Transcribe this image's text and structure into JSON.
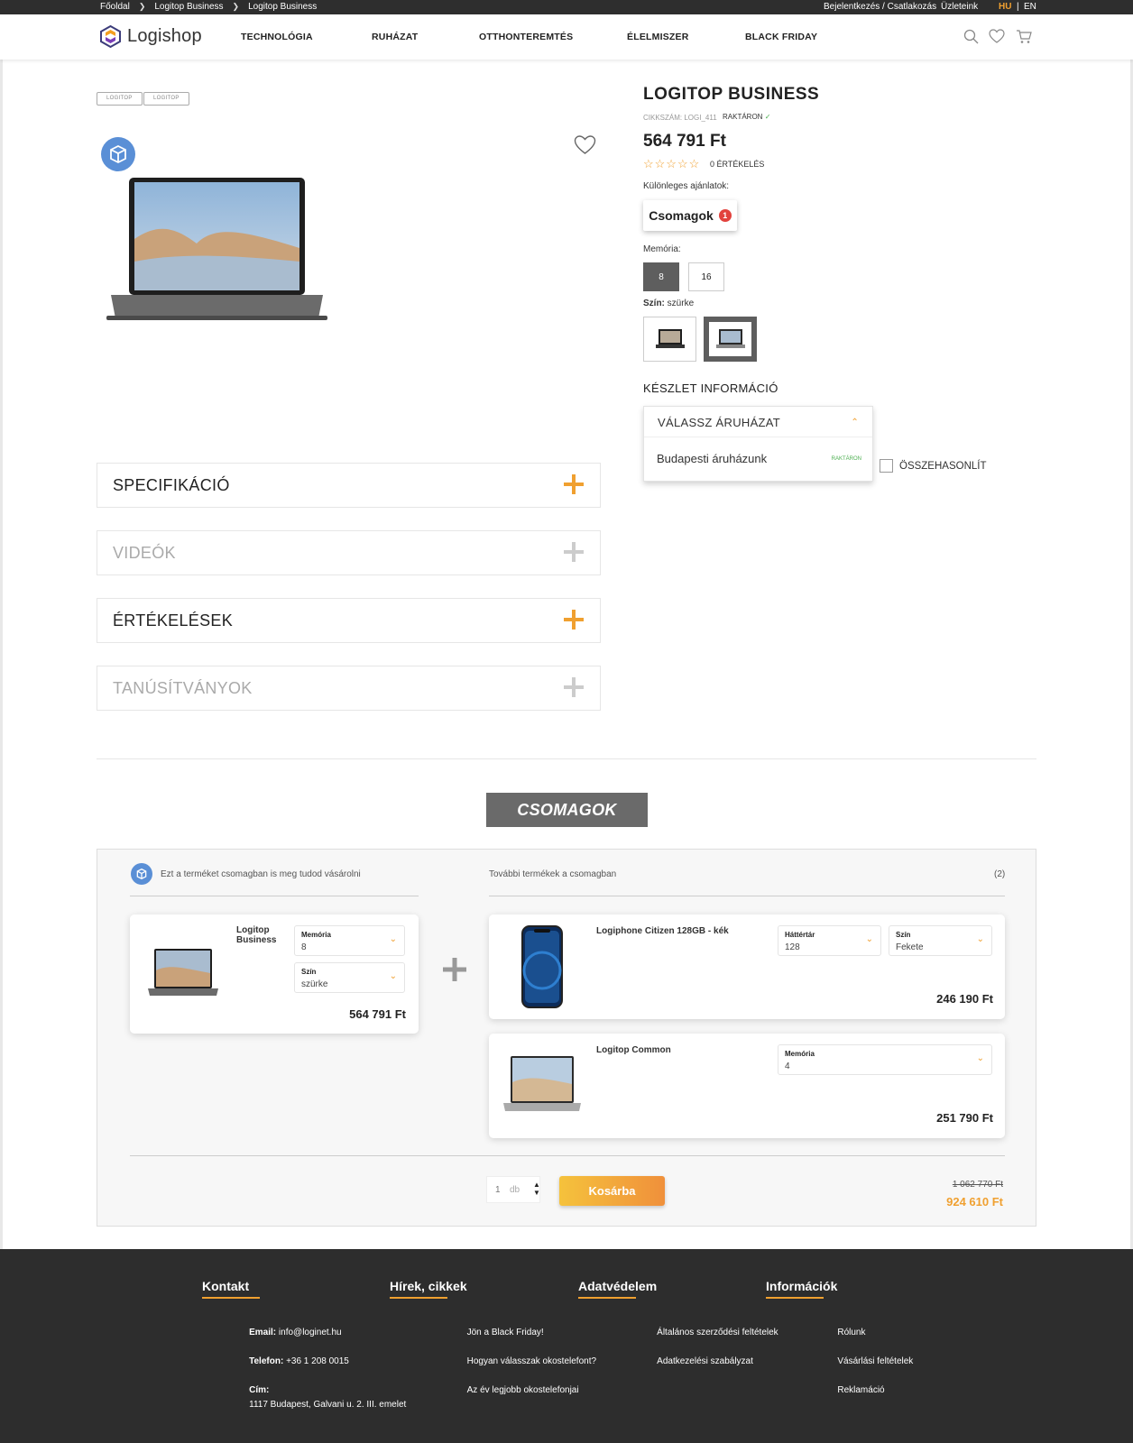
{
  "topbar": {
    "breadcrumb": [
      "Főoldal",
      "Logitop Business",
      "Logitop Business"
    ],
    "login": "Bejelentkezés / Csatlakozás",
    "stores": "Üzleteink",
    "lang_hu": "HU",
    "lang_sep": "|",
    "lang_en": "EN"
  },
  "header": {
    "logo": "Logishop",
    "nav": [
      "TECHNOLÓGIA",
      "RUHÁZAT",
      "OTTHONTEREMTÉS",
      "ÉLELMISZER",
      "BLACK FRIDAY"
    ]
  },
  "product": {
    "tags": [
      "LOGITOP",
      "LOGITOP"
    ],
    "name": "LOGITOP BUSINESS",
    "sku": "CIKKSZÁM: LOGI_411",
    "stock": "RAKTÁRON",
    "price": "564 791 Ft",
    "rating_stars": "☆☆☆☆☆",
    "reviews": "0 ÉRTÉKELÉS",
    "special_label": "Különleges ajánlatok:",
    "special_button": "Csomagok",
    "special_count": "1",
    "memory_label": "Memória:",
    "memory_options": [
      "8",
      "16"
    ],
    "color_label": "Szín:",
    "color_value": "szürke",
    "stock_info": "KÉSZLET INFORMÁCIÓ",
    "store_select": "VÁLASSZ ÁRUHÁZAT",
    "store_name": "Budapesti áruházunk",
    "store_stock": "RAKTÁRON",
    "compare": "ÖSSZEHASONLÍT"
  },
  "accordion": [
    "SPECIFIKÁCIÓ",
    "VIDEÓK",
    "ÉRTÉKELÉSEK",
    "TANÚSÍTVÁNYOK"
  ],
  "bundle": {
    "title": "CSOMAGOK",
    "left_caption": "Ezt a terméket csomagban is meg tudod vásárolni",
    "right_caption": "További termékek a csomagban",
    "count": "(2)",
    "main": {
      "name": "Logitop Business",
      "sel1_title": "Memória",
      "sel1_value": "8",
      "sel2_title": "Szín",
      "sel2_value": "szürke",
      "price": "564 791 Ft"
    },
    "item1": {
      "name": "Logiphone Citizen 128GB - kék",
      "sel1_title": "Háttértár",
      "sel1_value": "128",
      "sel2_title": "Szín",
      "sel2_value": "Fekete",
      "price": "246 190 Ft"
    },
    "item2": {
      "name": "Logitop Common",
      "sel1_title": "Memória",
      "sel1_value": "4",
      "price": "251 790 Ft"
    },
    "qty": "1",
    "qty_unit": "db",
    "cart_button": "Kosárba",
    "old_price": "1 062 770 Ft",
    "new_price": "924 610 Ft"
  },
  "footer": {
    "contact": {
      "title": "Kontakt",
      "email_label": "Email:",
      "email": "info@loginet.hu",
      "phone_label": "Telefon:",
      "phone": "+36 1 208 0015",
      "addr_label": "Cím:",
      "addr": "1117 Budapest, Galvani u. 2. III. emelet"
    },
    "news": {
      "title": "Hírek, cikkek",
      "items": [
        "Jön a Black Friday!",
        "Hogyan válasszak okostelefont?",
        "Az év legjobb okostelefonjai"
      ]
    },
    "privacy": {
      "title": "Adatvédelem",
      "items": [
        "Általános szerződési feltételek",
        "Adatkezelési szabályzat"
      ]
    },
    "info": {
      "title": "Információk",
      "items": [
        "Rólunk",
        "Vásárlási feltételek",
        "Reklamáció"
      ]
    }
  },
  "colors": {
    "accent": "#f0a030",
    "dark": "#2d2d2d",
    "badge_blue": "#5a8fd6",
    "red": "#e2423d"
  }
}
